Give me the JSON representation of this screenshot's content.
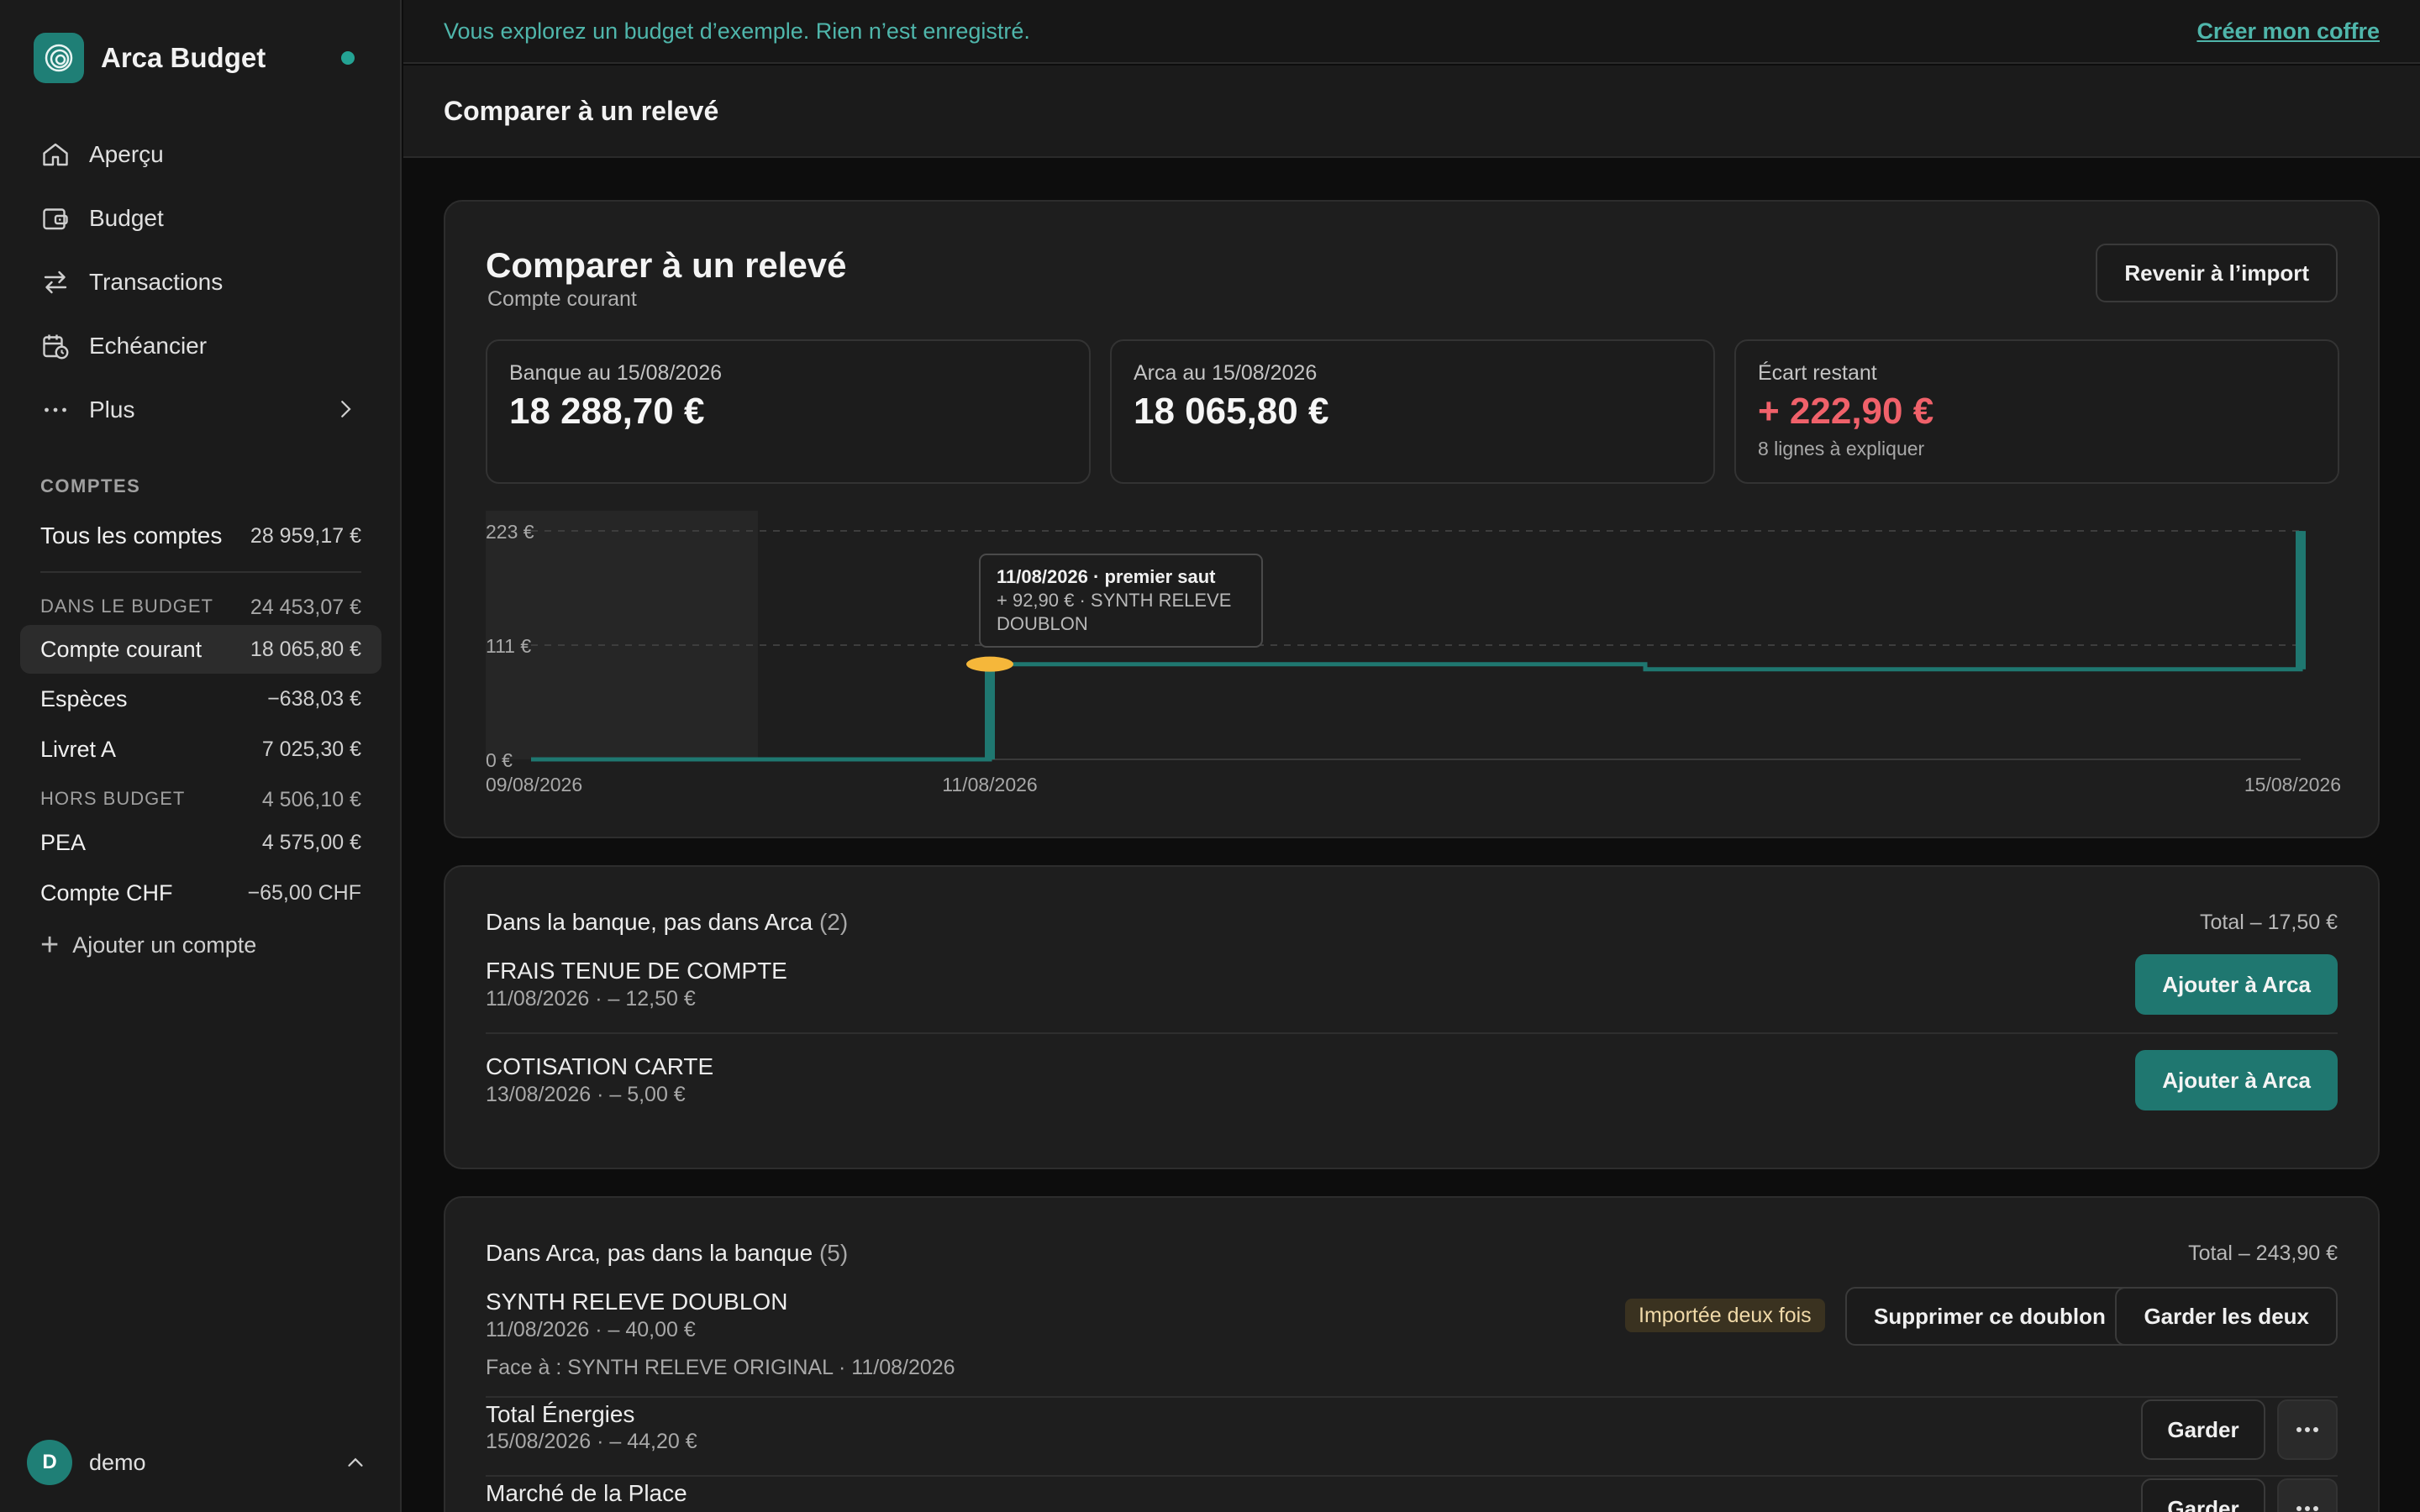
{
  "app": {
    "name": "Arca Budget"
  },
  "nav": [
    {
      "label": "Aperçu",
      "icon": "home-icon"
    },
    {
      "label": "Budget",
      "icon": "wallet-icon"
    },
    {
      "label": "Transactions",
      "icon": "transfer-icon"
    },
    {
      "label": "Echéancier",
      "icon": "calendar-clock-icon"
    },
    {
      "label": "Plus",
      "icon": "more-icon"
    }
  ],
  "accounts": {
    "section_label": "COMPTES",
    "all": {
      "label": "Tous les comptes",
      "value": "28 959,17 €"
    },
    "in_budget": {
      "label": "DANS LE BUDGET",
      "value": "24 453,07 €"
    },
    "in_budget_items": [
      {
        "label": "Compte courant",
        "value": "18 065,80 €"
      },
      {
        "label": "Espèces",
        "value": "−638,03 €"
      },
      {
        "label": "Livret A",
        "value": "7 025,30 €"
      }
    ],
    "off_budget": {
      "label": "HORS BUDGET",
      "value": "4 506,10 €"
    },
    "off_budget_items": [
      {
        "label": "PEA",
        "value": "4 575,00 €"
      },
      {
        "label": "Compte CHF",
        "value": "−65,00 CHF"
      }
    ],
    "add_label": "Ajouter un compte"
  },
  "user": {
    "initial": "D",
    "name": "demo"
  },
  "banner": {
    "text": "Vous explorez un budget d’exemple. Rien n’est enregistré.",
    "link": "Créer mon coffre"
  },
  "page": {
    "title": "Comparer à un relevé"
  },
  "summary": {
    "title": "Comparer à un relevé",
    "subtitle": "Compte courant",
    "back_button": "Revenir à l’import",
    "stats": [
      {
        "label": "Banque au 15/08/2026",
        "value": "18 288,70 €"
      },
      {
        "label": "Arca au 15/08/2026",
        "value": "18 065,80 €"
      },
      {
        "label": "Écart restant",
        "value": "+ 222,90 €",
        "note": "8 lignes à expliquer"
      }
    ]
  },
  "chart_data": {
    "type": "line",
    "y_ticks": [
      "223 €",
      "111 €",
      "0 €"
    ],
    "ylim": [
      0,
      223
    ],
    "x_tick_labels": [
      "09/08/2026",
      "11/08/2026",
      "15/08/2026"
    ],
    "series": [
      {
        "values": [
          {
            "x": "09/08/2026",
            "y": 0
          },
          {
            "x": "11/08/2026",
            "y": 0
          },
          {
            "x": "11/08/2026",
            "y": 92.9
          },
          {
            "x": "13/08/2026",
            "y": 92.9
          },
          {
            "x": "13/08/2026",
            "y": 87.9
          },
          {
            "x": "15/08/2026",
            "y": 87.9
          },
          {
            "x": "15/08/2026",
            "y": 222.9
          }
        ]
      }
    ],
    "marker": {
      "x": "11/08/2026",
      "y": 92.9
    },
    "tooltip": {
      "title": "11/08/2026 · premier saut",
      "line1": "+ 92,90 € · SYNTH RELEVE",
      "line2": "DOUBLON"
    },
    "colors": {
      "line": "#1f7770",
      "marker": "#f5b73a"
    }
  },
  "bank_only": {
    "title": "Dans la banque, pas dans Arca",
    "count": "(2)",
    "total": "Total – 17,50 €",
    "items": [
      {
        "name": "FRAIS TENUE DE COMPTE",
        "meta": "11/08/2026 · – 12,50 €",
        "action": "Ajouter à Arca"
      },
      {
        "name": "COTISATION CARTE",
        "meta": "13/08/2026 · – 5,00 €",
        "action": "Ajouter à Arca"
      }
    ]
  },
  "arca_only": {
    "title": "Dans Arca, pas dans la banque",
    "count": "(5)",
    "total": "Total – 243,90 €",
    "items": [
      {
        "name": "SYNTH RELEVE DOUBLON",
        "meta": "11/08/2026 · – 40,00 €",
        "badge": "Importée deux fois",
        "delete": "Supprimer ce doublon",
        "keep_both": "Garder les deux",
        "face": "Face à : SYNTH RELEVE ORIGINAL · 11/08/2026"
      },
      {
        "name": "Total Énergies",
        "meta": "15/08/2026 · – 44,20 €",
        "keep": "Garder"
      },
      {
        "name": "Marché de la Place",
        "keep": "Garder"
      }
    ]
  },
  "colors": {
    "accent": "#1f7770",
    "accent_text": "#4fb6ab",
    "negative": "#f0616a",
    "marker": "#f5b73a"
  }
}
